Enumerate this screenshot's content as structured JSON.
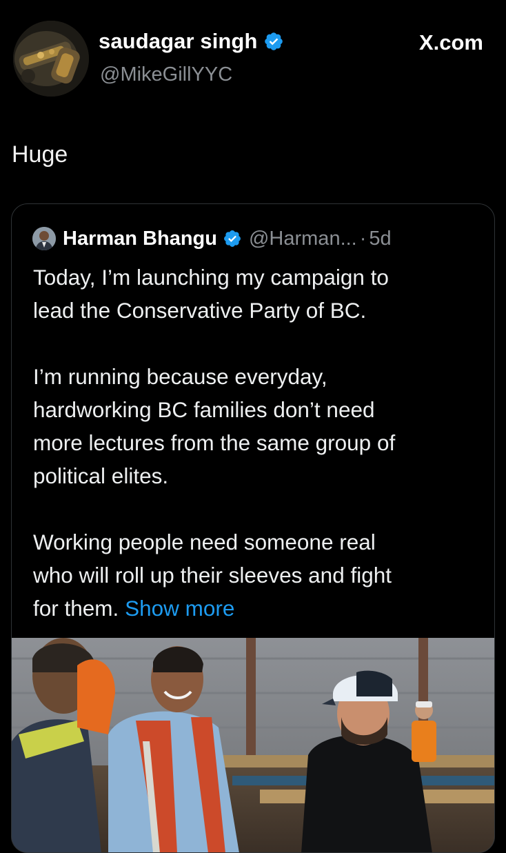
{
  "post": {
    "author_name": "saudagar singh",
    "author_handle": "@MikeGillYYC",
    "site_label": "X.com",
    "text": "Huge",
    "verified_icon": "verified-badge-icon"
  },
  "quoted_post": {
    "author_name": "Harman Bhangu",
    "author_handle": "@Harman...",
    "separator": "·",
    "time": "5d",
    "lines": [
      "Today, I’m launching my campaign to",
      "lead the Conservative Party of BC.",
      "",
      "I’m running because everyday,",
      "hardworking BC families don’t need",
      "more lectures from the same group of",
      "political elites.",
      "",
      "Working people need someone real",
      "who will roll up their sleeves and fight"
    ],
    "last_line_text": "for them.",
    "show_more_label": "Show more",
    "link_color": "#1d9bf0"
  },
  "colors": {
    "background": "#000000",
    "text_primary": "#e7e9ea",
    "text_secondary": "#8b8f94",
    "verified": "#1d9bf0",
    "card_border": "#2f3336"
  }
}
